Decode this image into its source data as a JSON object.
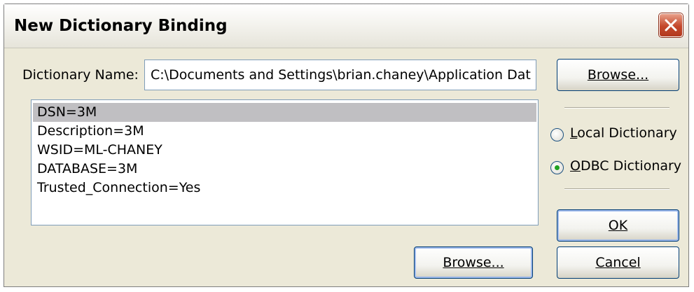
{
  "window": {
    "title": "New Dictionary Binding",
    "close_icon": "close-icon"
  },
  "form": {
    "name_label": "Dictionary Name:",
    "name_value": "C:\\Documents and Settings\\brian.chaney\\Application Dat",
    "browse_top_label": "Browse...",
    "browse_bottom_label": "Browse..."
  },
  "list": {
    "items": [
      {
        "text": "DSN=3M",
        "selected": true
      },
      {
        "text": "Description=3M",
        "selected": false
      },
      {
        "text": "WSID=ML-CHANEY",
        "selected": false
      },
      {
        "text": "DATABASE=3M",
        "selected": false
      },
      {
        "text": "Trusted_Connection=Yes",
        "selected": false
      }
    ]
  },
  "options": {
    "local_label": "Local Dictionary",
    "local_checked": false,
    "odbc_label": "ODBC Dictionary",
    "odbc_checked": true
  },
  "actions": {
    "ok_label": "OK",
    "cancel_label": "Cancel"
  },
  "colors": {
    "dialog_bg": "#ece9d8",
    "selection_bg": "#c0bfc2",
    "close_red": "#c4472b",
    "radio_dot": "#21a121"
  }
}
